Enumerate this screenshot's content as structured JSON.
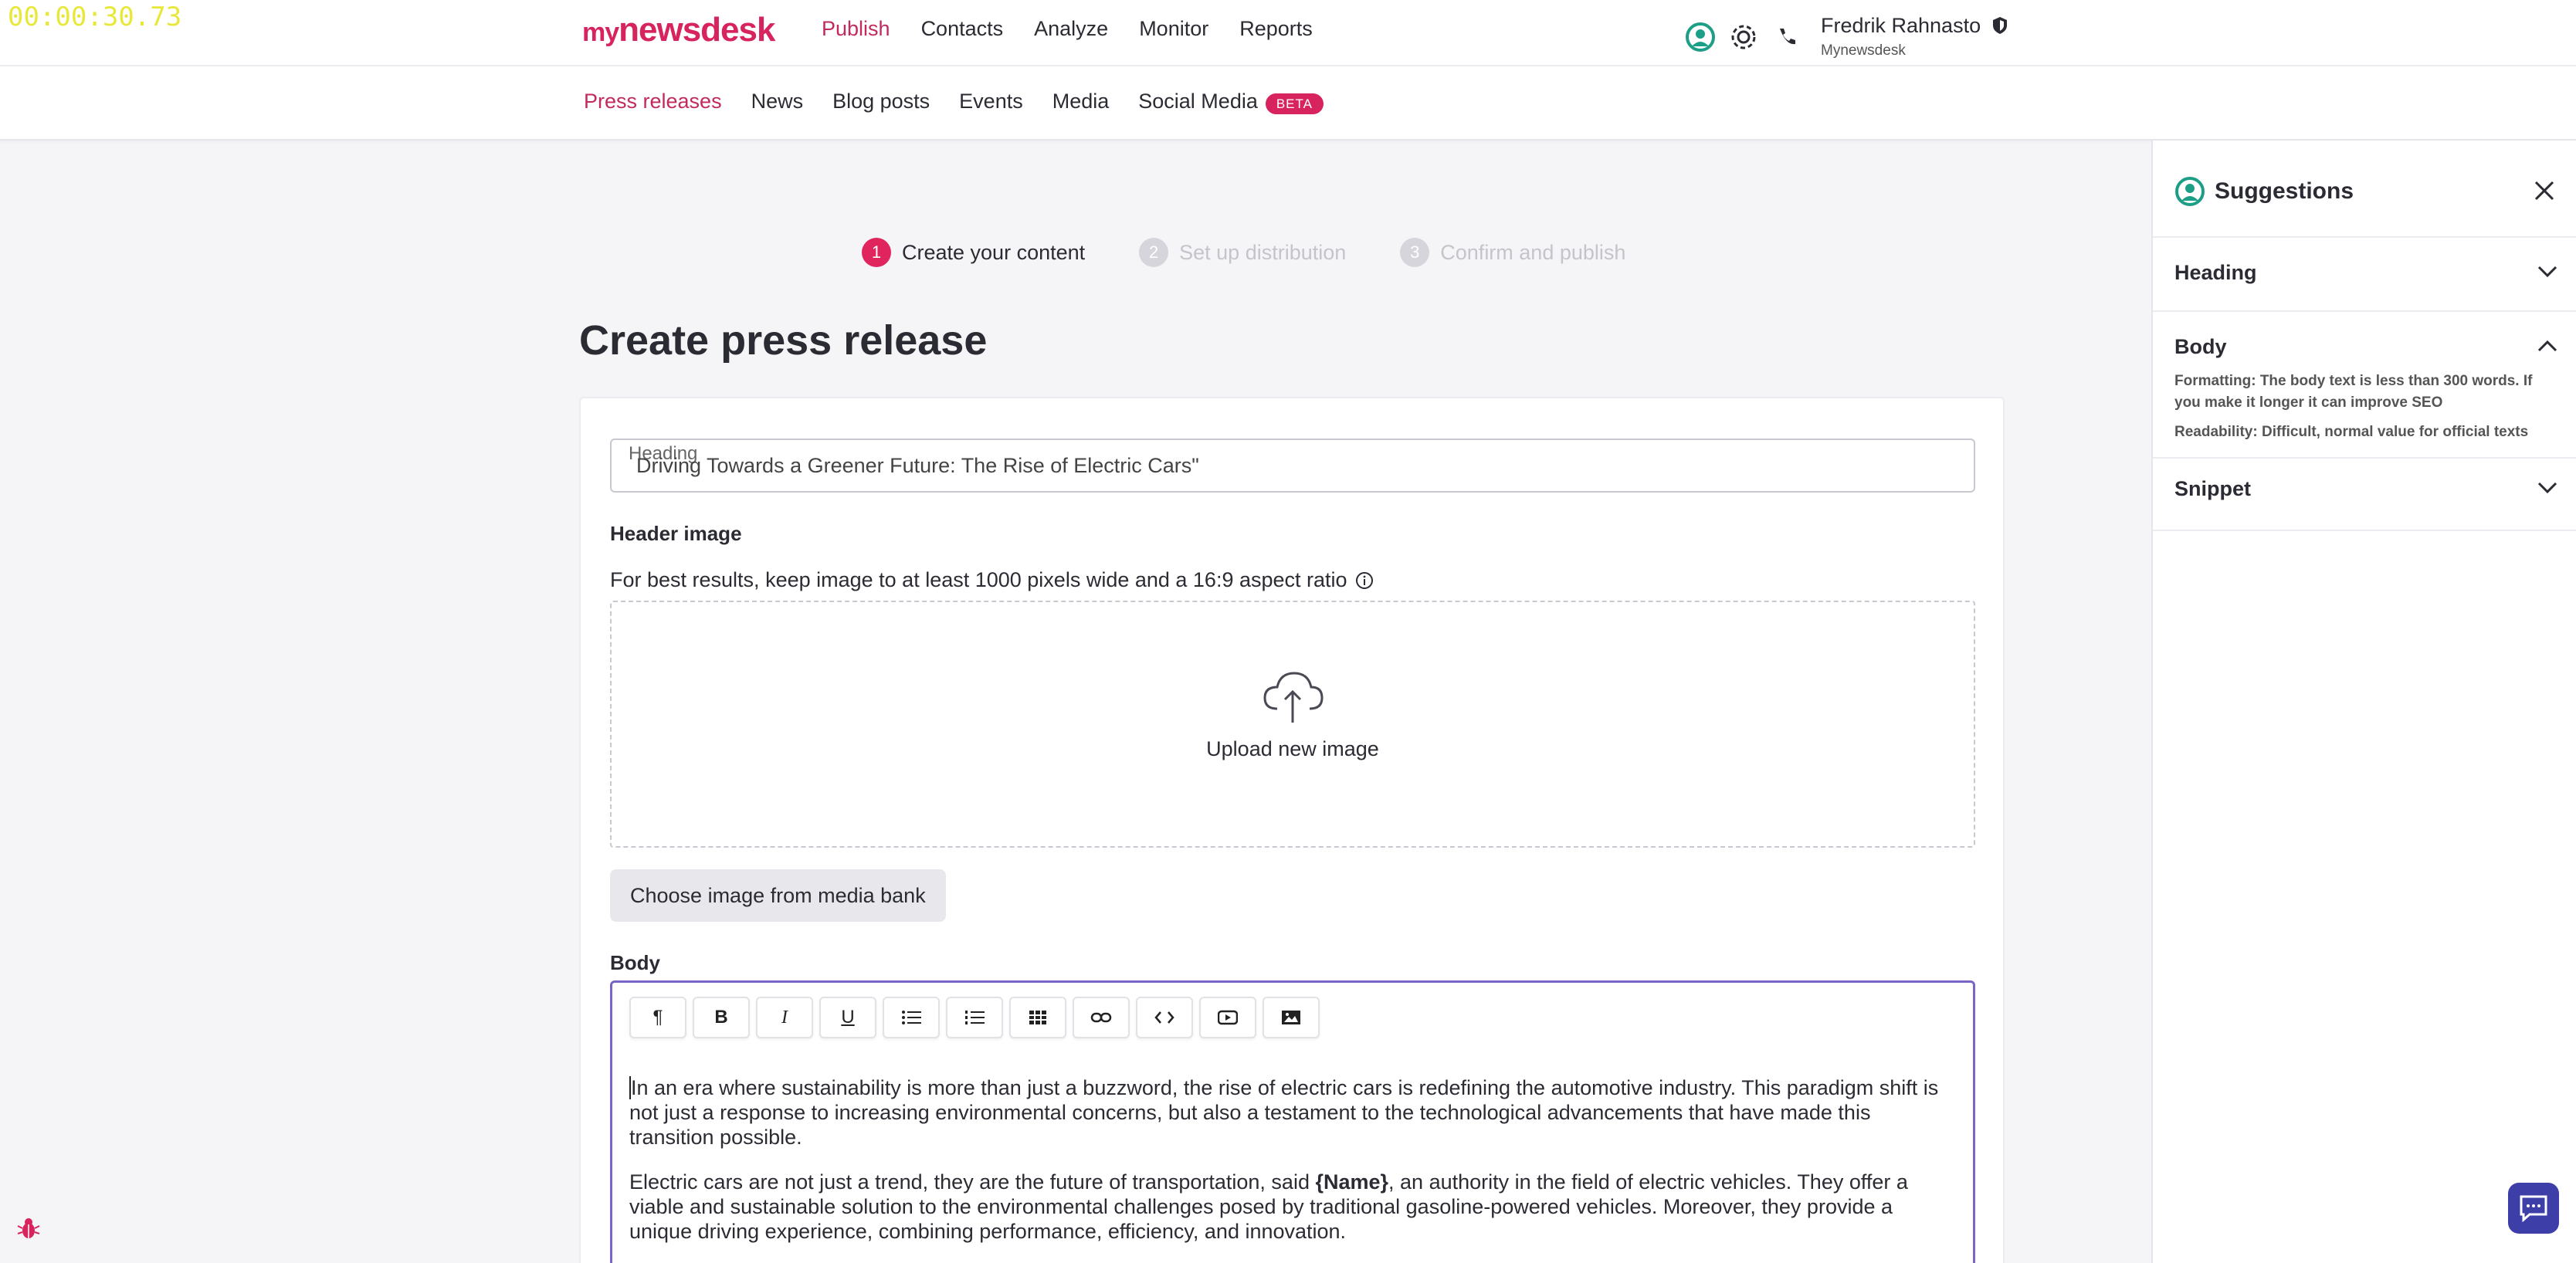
{
  "timer": "00:00:30.73",
  "topbar": {
    "logo_prefix": "my",
    "logo_main": "newsdesk",
    "nav": [
      "Publish",
      "Contacts",
      "Analyze",
      "Monitor",
      "Reports"
    ],
    "active_nav": "Publish",
    "user_name": "Fredrik Rahnasto",
    "user_org": "Mynewsdesk"
  },
  "subnav": {
    "items": [
      "Press releases",
      "News",
      "Blog posts",
      "Events",
      "Media",
      "Social Media"
    ],
    "active": "Press releases",
    "beta_badge": "BETA"
  },
  "steps": [
    {
      "num": "1",
      "label": "Create your content"
    },
    {
      "num": "2",
      "label": "Set up distribution"
    },
    {
      "num": "3",
      "label": "Confirm and publish"
    }
  ],
  "page_title": "Create press release",
  "form": {
    "heading_label": "Heading",
    "heading_value": "Driving Towards a Greener Future: The Rise of Electric Cars\"",
    "header_image_label": "Header image",
    "header_image_hint": "For best results, keep image to at least 1000 pixels wide and a 16:9 aspect ratio",
    "upload_label": "Upload new image",
    "media_bank_button": "Choose image from media bank",
    "body_label": "Body",
    "toolbar": [
      "paragraph-icon",
      "bold-icon",
      "italic-icon",
      "underline-icon",
      "bullet-list-icon",
      "numbered-list-icon",
      "table-icon",
      "link-icon",
      "code-icon",
      "video-icon",
      "image-icon"
    ],
    "body_p1": "In an era where sustainability is more than just a buzzword, the rise of electric cars is redefining the automotive industry. This paradigm shift is not just a response to increasing environmental concerns, but also a testament to the technological advancements that have made this transition possible.",
    "body_p2_a": "Electric cars are not just a trend, they are the future of transportation, said ",
    "body_p2_name": "{Name}",
    "body_p2_b": ", an authority in the field of electric vehicles. They offer a viable and sustainable solution to the environmental challenges posed by traditional gasoline-powered vehicles. Moreover, they provide a unique driving experience, combining performance, efficiency, and innovation."
  },
  "suggestions": {
    "title": "Suggestions",
    "sections": [
      "Heading",
      "Body",
      "Snippet"
    ],
    "body_formatting": "Formatting: The body text is less than 300 words. If you make it longer it can improve SEO",
    "body_readability": "Readability: Difficult, normal value for official texts"
  },
  "colors": {
    "brand": "#d8245e",
    "active_link": "#c22a5f",
    "editor_focus": "#7a64c8",
    "timer": "#e8e83a"
  }
}
